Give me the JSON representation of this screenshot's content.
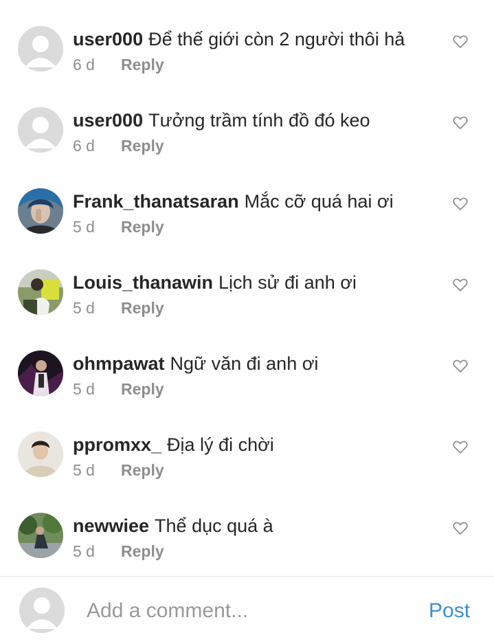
{
  "comments": [
    {
      "username": "user000",
      "text": "Để thế giới còn 2 người thôi hả",
      "time": "6 d",
      "reply": "Reply",
      "avatar": "default-avatar"
    },
    {
      "username": "user000",
      "text": "Tưởng trầm tính đồ đó keo",
      "time": "6 d",
      "reply": "Reply",
      "avatar": "default-avatar"
    },
    {
      "username": "Frank_thanatsaran",
      "text": "Mắc cỡ quá hai ơi",
      "time": "5 d",
      "reply": "Reply",
      "avatar": "photo-avatar"
    },
    {
      "username": "Louis_thanawin",
      "text": "Lịch sử đi anh ơi",
      "time": "5 d",
      "reply": "Reply",
      "avatar": "photo-avatar"
    },
    {
      "username": "ohmpawat",
      "text": "Ngữ văn đi anh ơi",
      "time": "5 d",
      "reply": "Reply",
      "avatar": "photo-avatar"
    },
    {
      "username": "ppromxx_",
      "text": "Địa lý đi chời",
      "time": "5 d",
      "reply": "Reply",
      "avatar": "photo-avatar"
    },
    {
      "username": "newwiee",
      "text": "Thể dục quá à",
      "time": "5 d",
      "reply": "Reply",
      "avatar": "photo-avatar"
    }
  ],
  "composer": {
    "placeholder": "Add a comment...",
    "post_label": "Post"
  },
  "colors": {
    "text": "#262626",
    "muted": "#8e8e8e",
    "link": "#3d8fd6",
    "default_avatar": "#dbdbdb"
  }
}
